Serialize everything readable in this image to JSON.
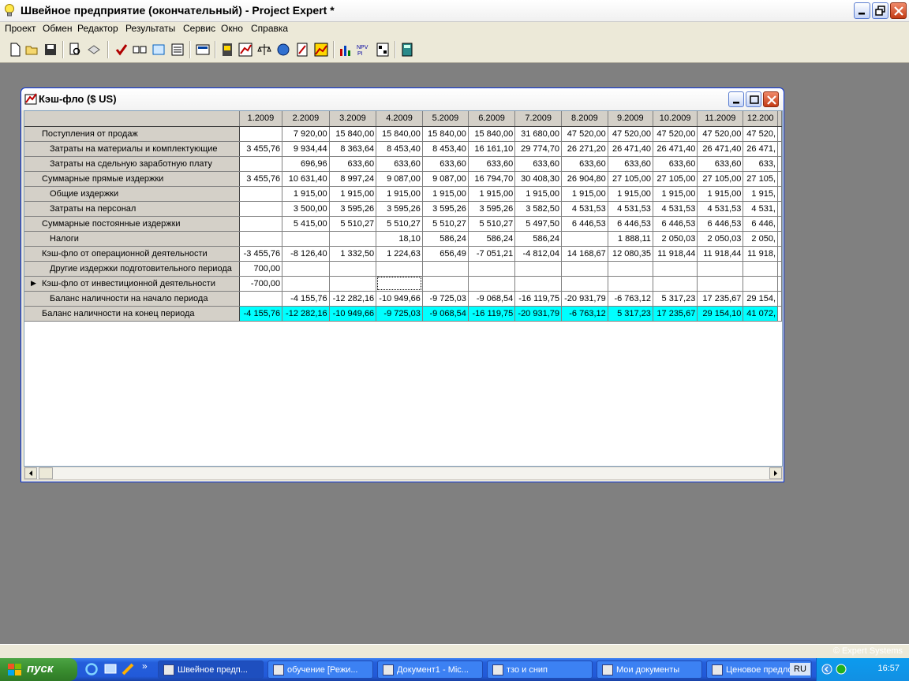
{
  "app": {
    "title": "Швейное предприятие (окончательный) - Project Expert *"
  },
  "menu": [
    "Проект",
    "Обмен",
    "Редактор",
    "Результаты",
    "Сервис",
    "Окно",
    "Справка"
  ],
  "child_window": {
    "title": "Кэш-фло ($ US)"
  },
  "table": {
    "columns": [
      "1.2009",
      "2.2009",
      "3.2009",
      "4.2009",
      "5.2009",
      "6.2009",
      "7.2009",
      "8.2009",
      "9.2009",
      "10.2009",
      "11.2009",
      "12.200"
    ],
    "rows": [
      {
        "label": "Поступления от продаж",
        "indent": 1,
        "values": [
          "",
          "7 920,00",
          "15 840,00",
          "15 840,00",
          "15 840,00",
          "15 840,00",
          "31 680,00",
          "47 520,00",
          "47 520,00",
          "47 520,00",
          "47 520,00",
          "47 520,"
        ]
      },
      {
        "label": "Затраты на материалы и комплектующие",
        "indent": 2,
        "values": [
          "3 455,76",
          "9 934,44",
          "8 363,64",
          "8 453,40",
          "8 453,40",
          "16 161,10",
          "29 774,70",
          "26 271,20",
          "26 471,40",
          "26 471,40",
          "26 471,40",
          "26 471,"
        ]
      },
      {
        "label": "Затраты на сдельную заработную плату",
        "indent": 2,
        "values": [
          "",
          "696,96",
          "633,60",
          "633,60",
          "633,60",
          "633,60",
          "633,60",
          "633,60",
          "633,60",
          "633,60",
          "633,60",
          "633,"
        ]
      },
      {
        "label": "Суммарные прямые издержки",
        "indent": 1,
        "values": [
          "3 455,76",
          "10 631,40",
          "8 997,24",
          "9 087,00",
          "9 087,00",
          "16 794,70",
          "30 408,30",
          "26 904,80",
          "27 105,00",
          "27 105,00",
          "27 105,00",
          "27 105,"
        ]
      },
      {
        "label": "Общие издержки",
        "indent": 2,
        "values": [
          "",
          "1 915,00",
          "1 915,00",
          "1 915,00",
          "1 915,00",
          "1 915,00",
          "1 915,00",
          "1 915,00",
          "1 915,00",
          "1 915,00",
          "1 915,00",
          "1 915,"
        ]
      },
      {
        "label": "Затраты на персонал",
        "indent": 2,
        "values": [
          "",
          "3 500,00",
          "3 595,26",
          "3 595,26",
          "3 595,26",
          "3 595,26",
          "3 582,50",
          "4 531,53",
          "4 531,53",
          "4 531,53",
          "4 531,53",
          "4 531,"
        ]
      },
      {
        "label": "Суммарные постоянные издержки",
        "indent": 1,
        "values": [
          "",
          "5 415,00",
          "5 510,27",
          "5 510,27",
          "5 510,27",
          "5 510,27",
          "5 497,50",
          "6 446,53",
          "6 446,53",
          "6 446,53",
          "6 446,53",
          "6 446,"
        ]
      },
      {
        "label": "Налоги",
        "indent": 2,
        "values": [
          "",
          "",
          "",
          "18,10",
          "586,24",
          "586,24",
          "586,24",
          "",
          "1 888,11",
          "2 050,03",
          "2 050,03",
          "2 050,"
        ]
      },
      {
        "label": "Кэш-фло от операционной деятельности",
        "indent": 1,
        "values": [
          "-3 455,76",
          "-8 126,40",
          "1 332,50",
          "1 224,63",
          "656,49",
          "-7 051,21",
          "-4 812,04",
          "14 168,67",
          "12 080,35",
          "11 918,44",
          "11 918,44",
          "11 918,"
        ]
      },
      {
        "label": "Другие издержки подготовительного периода",
        "indent": 2,
        "values": [
          "700,00",
          "",
          "",
          "",
          "",
          "",
          "",
          "",
          "",
          "",
          "",
          ""
        ]
      },
      {
        "label": "Кэш-фло от инвестиционной деятельности",
        "indent": 1,
        "marker": "▶",
        "values": [
          "-700,00",
          "",
          "",
          "",
          "",
          "",
          "",
          "",
          "",
          "",
          "",
          ""
        ]
      },
      {
        "label": "Баланс наличности на начало периода",
        "indent": 2,
        "values": [
          "",
          "-4 155,76",
          "-12 282,16",
          "-10 949,66",
          "-9 725,03",
          "-9 068,54",
          "-16 119,75",
          "-20 931,79",
          "-6 763,12",
          "5 317,23",
          "17 235,67",
          "29 154,"
        ]
      },
      {
        "label": "Баланс наличности на конец периода",
        "indent": 1,
        "highlight": true,
        "values": [
          "-4 155,76",
          "-12 282,16",
          "-10 949,66",
          "-9 725,03",
          "-9 068,54",
          "-16 119,75",
          "-20 931,79",
          "-6 763,12",
          "5 317,23",
          "17 235,67",
          "29 154,10",
          "41 072,"
        ]
      }
    ]
  },
  "status": {
    "copyright": "© Expert Systems"
  },
  "taskbar": {
    "start_label": "пуск",
    "tasks": [
      "Швейное предп...",
      "обучение [Режи...",
      "Документ1 - Mic...",
      "тзо и снип",
      "Мои документы",
      "Ценовое предло..."
    ],
    "lang": "RU",
    "clock": "16:57"
  },
  "colors": {
    "highlight_row": "#00ffff",
    "label_bg": "#d4d0c8",
    "taskbar": "#245edb",
    "start": "#3a8e30"
  }
}
